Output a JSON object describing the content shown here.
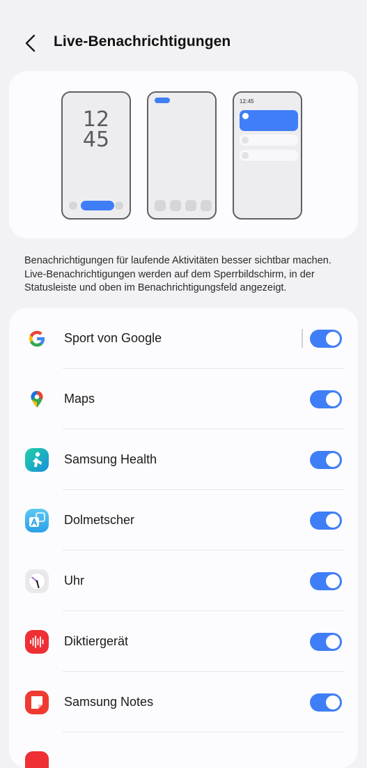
{
  "header": {
    "title": "Live-Benachrichtigungen"
  },
  "preview": {
    "lockscreen_time_hours": "12",
    "lockscreen_time_minutes": "45",
    "panel_time": "12:45"
  },
  "description": "Benachrichtigungen für laufende Aktivitäten besser sichtbar machen. Live-Benachrichtigungen werden auf dem Sperrbildschirm, in der Statusleiste und oben im Benachrichtigungsfeld angezeigt.",
  "apps": [
    {
      "label": "Sport von Google",
      "icon": "google-icon",
      "enabled": true
    },
    {
      "label": "Maps",
      "icon": "maps-pin-icon",
      "enabled": true
    },
    {
      "label": "Samsung Health",
      "icon": "samsung-health-icon",
      "enabled": true
    },
    {
      "label": "Dolmetscher",
      "icon": "translator-icon",
      "enabled": true
    },
    {
      "label": "Uhr",
      "icon": "clock-icon",
      "enabled": true
    },
    {
      "label": "Diktiergerät",
      "icon": "voice-recorder-icon",
      "enabled": true
    },
    {
      "label": "Samsung Notes",
      "icon": "notes-icon",
      "enabled": true
    }
  ],
  "colors": {
    "accent": "#3f7ef6",
    "background": "#f2f2f4",
    "card": "#fcfcfe"
  }
}
